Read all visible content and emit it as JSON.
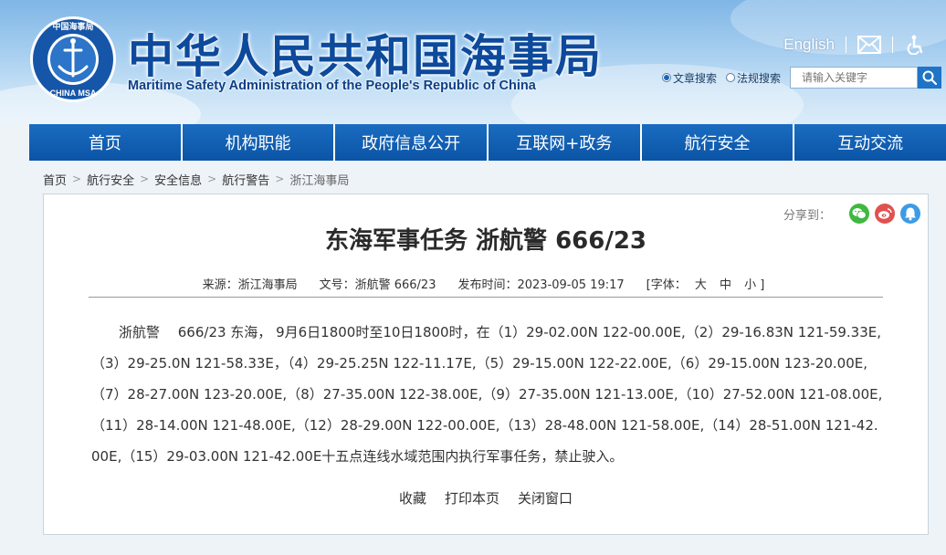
{
  "header": {
    "logo_top_text": "中国海事局",
    "logo_bottom_text": "CHINA MSA",
    "title_cn": "中华人民共和国海事局",
    "title_en": "Maritime Safety Administration of the People's Republic of China",
    "english_link": "English",
    "search": {
      "option_article": "文章搜索",
      "option_law": "法规搜索",
      "placeholder": "请输入关键字"
    }
  },
  "nav": {
    "items": [
      "首页",
      "机构职能",
      "政府信息公开",
      "互联网+政务",
      "航行安全",
      "互动交流"
    ]
  },
  "breadcrumb": [
    "首页",
    "航行安全",
    "安全信息",
    "航行警告",
    "浙江海事局"
  ],
  "article": {
    "share_label": "分享到：",
    "title": "东海军事任务 浙航警 666/23",
    "meta": {
      "source": "来源：浙江海事局",
      "doc_no": "文号：浙航警 666/23",
      "published": "发布时间：2023-09-05 19:17",
      "font_label": "[字体：",
      "font_large": "大",
      "font_medium": "中",
      "font_small": "小 ]"
    },
    "body": "浙航警　 666/23  东海， 9月6日1800时至10日1800时，在（1）29-02.00N 122-00.00E,（2）29-16.83N 121-59.33E,（3）29-25.0N 121-58.33E，（4）29-25.25N 122-11.17E,（5）29-15.00N 122-22.00E,（6）29-15.00N 123-20.00E,（7）28-27.00N 123-20.00E,（8）27-35.00N 122-38.00E,（9）27-35.00N 121-13.00E,（10）27-52.00N 121-08.00E,（11）28-14.00N 121-48.00E,（12）28-29.00N 122-00.00E,（13）28-48.00N 121-58.00E,（14）28-51.00N 121-42.00E,（15）29-03.00N 121-42.00E十五点连线水域范围内执行军事任务，禁止驶入。",
    "actions": {
      "favorite": "收藏",
      "print": "打印本页",
      "close": "关闭窗口"
    }
  },
  "colors": {
    "brand_blue": "#0d4a9c",
    "nav_blue": "#0f5cae",
    "wechat_green": "#3fb83f",
    "weibo_red": "#e0524f",
    "qq_blue": "#3d9be6"
  }
}
